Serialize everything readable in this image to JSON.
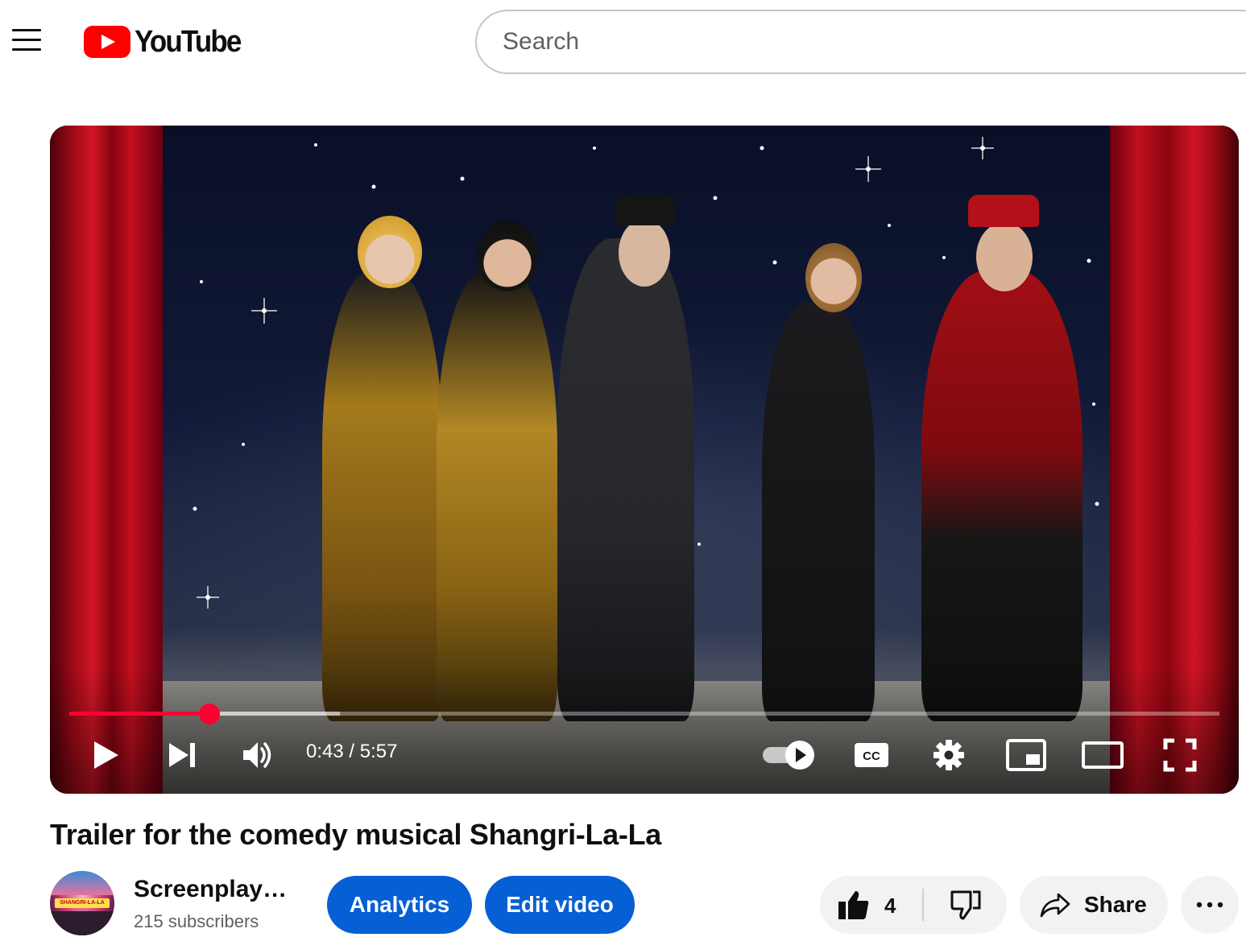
{
  "app": {
    "logo_text": "YouTube"
  },
  "search": {
    "placeholder": "Search",
    "value": ""
  },
  "player": {
    "current_time": "0:43",
    "duration": "5:57",
    "time_display": "0:43 / 5:57",
    "progress_fraction": 0.122,
    "buffered_fraction": 0.235,
    "autoplay_on": true,
    "controls": [
      "play-icon",
      "next-icon",
      "volume-icon",
      "autoplay-toggle",
      "captions-icon",
      "settings-icon",
      "miniplayer-icon",
      "theater-mode-icon",
      "fullscreen-icon"
    ]
  },
  "video": {
    "title": "Trailer for the comedy musical Shangri-La-La"
  },
  "channel": {
    "name": "Screenplay…",
    "subscribers": "215 subscribers",
    "avatar_text": "SHANGRI-LA-LA"
  },
  "actions": {
    "analytics_label": "Analytics",
    "edit_video_label": "Edit video",
    "like_count": "4",
    "share_label": "Share"
  },
  "colors": {
    "brand_red": "#ff0000",
    "progress_red": "#ff0033",
    "button_blue": "#065fd4",
    "pill_gray": "#f2f2f2"
  }
}
